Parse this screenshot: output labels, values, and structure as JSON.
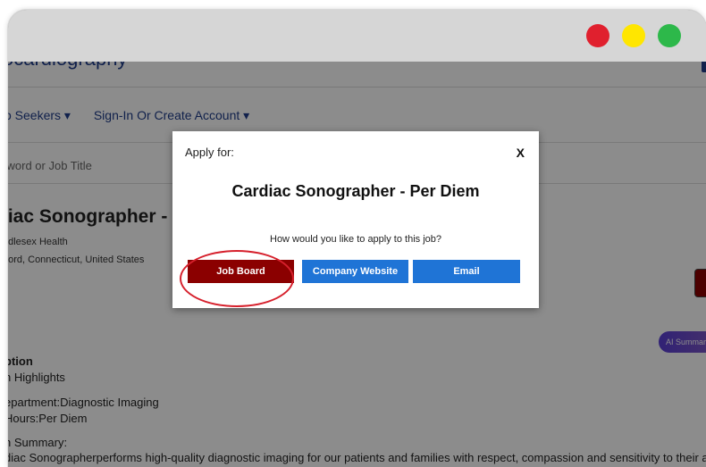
{
  "window": {
    "controls": {
      "close_color": "#e0202e",
      "minimize_color": "#ffe600",
      "zoom_color": "#2db84a"
    }
  },
  "site": {
    "title": "ocardiography"
  },
  "nav": {
    "items": [
      {
        "label": "o Seekers ▾"
      },
      {
        "label": "Sign-In Or Create Account ▾"
      }
    ]
  },
  "search": {
    "placeholder": "yword or Job Title"
  },
  "job": {
    "title": "liac Sonographer - Per",
    "employer": "ddlesex Health",
    "location": "tford, Connecticut, United States"
  },
  "ai_summary_label": "AI Summary",
  "description": {
    "heading": "ption",
    "highlights": "n Highlights",
    "department": "epartment:Diagnostic Imaging",
    "hours": "Hours:Per Diem",
    "summary_label": "n Summary:",
    "summary_text": "diac Sonographerperforms high-quality diagnostic imaging for our patients and families with respect, compassion and sensitivity to their age-"
  },
  "modal": {
    "header": "Apply for:",
    "close_label": "X",
    "job_title": "Cardiac Sonographer - Per Diem",
    "question": "How would you like to apply to this job?",
    "buttons": {
      "job_board": "Job Board",
      "company_website": "Company Website",
      "email": "Email"
    }
  }
}
